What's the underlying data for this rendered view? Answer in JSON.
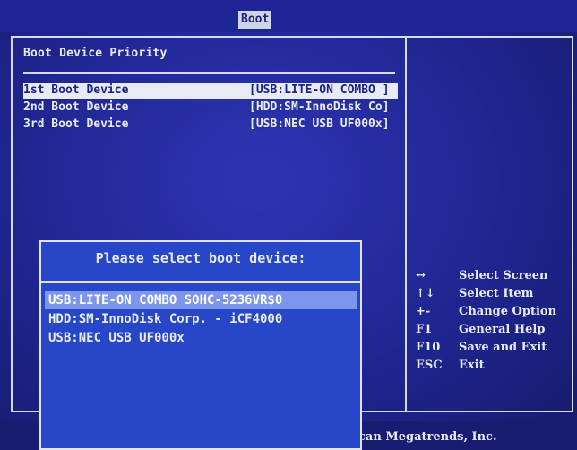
{
  "header": {
    "tab": "Boot"
  },
  "left": {
    "title": "Boot Device Priority",
    "rows": [
      {
        "label": "1st Boot Device",
        "value": "[USB:LITE-ON COMBO ]"
      },
      {
        "label": "2nd Boot Device",
        "value": "[HDD:SM-InnoDisk Co]"
      },
      {
        "label": "3rd Boot Device",
        "value": "[USB:NEC USB UF000x]"
      }
    ]
  },
  "help": [
    {
      "key": "↔",
      "action": "Select Screen"
    },
    {
      "key": "↑↓",
      "action": "Select Item"
    },
    {
      "key": "+-",
      "action": "Change Option"
    },
    {
      "key": "F1",
      "action": "General Help"
    },
    {
      "key": "F10",
      "action": "Save and Exit"
    },
    {
      "key": "ESC",
      "action": "Exit"
    }
  ],
  "footer": {
    "copyright": "can Megatrends, Inc."
  },
  "popup": {
    "title": "Please select boot device:",
    "items": [
      "USB:LITE-ON COMBO SOHC-5236VR$0",
      "HDD:SM-InnoDisk Corp. - iCF4000",
      "USB:NEC USB UF000x"
    ]
  },
  "colors": {
    "bios_blue": "#1f2590",
    "popup_blue": "#2747c8",
    "highlight": "#e8ebf6",
    "popup_highlight": "#7b96ea"
  }
}
